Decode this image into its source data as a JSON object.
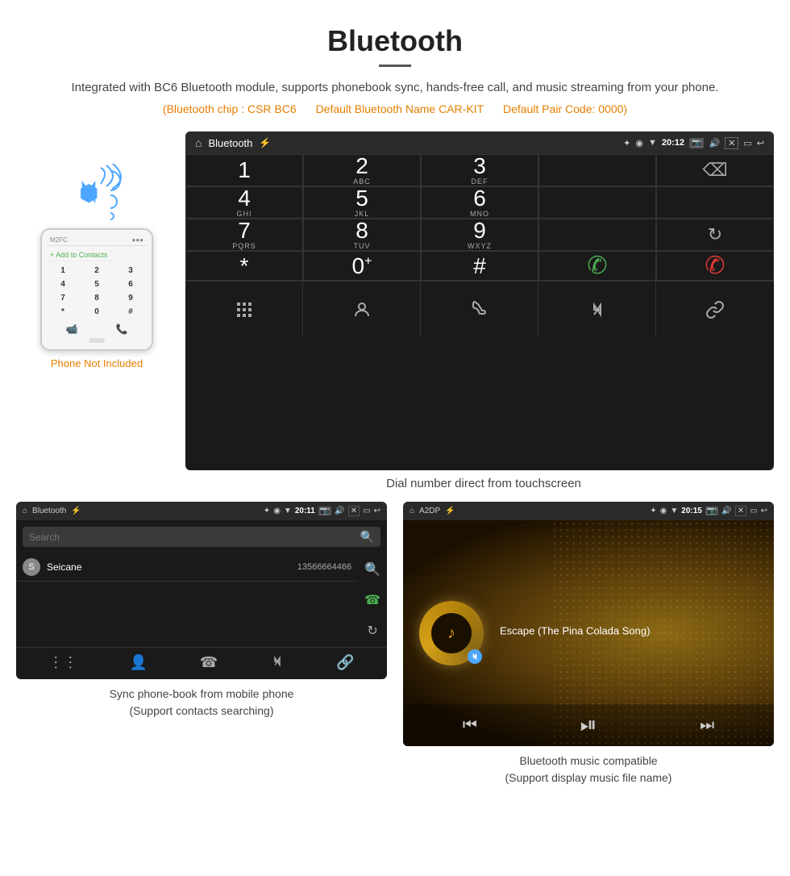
{
  "header": {
    "title": "Bluetooth",
    "description": "Integrated with BC6 Bluetooth module, supports phonebook sync, hands-free call, and music streaming from your phone.",
    "specs": {
      "chip": "(Bluetooth chip : CSR BC6",
      "name": "Default Bluetooth Name CAR-KIT",
      "pair": "Default Pair Code: 0000)"
    }
  },
  "phone_label": "Phone Not Included",
  "car_screen": {
    "status": {
      "title": "Bluetooth",
      "time": "20:12"
    },
    "dialpad": [
      {
        "num": "1",
        "letters": ""
      },
      {
        "num": "2",
        "letters": "ABC"
      },
      {
        "num": "3",
        "letters": "DEF"
      },
      {
        "num": "",
        "letters": ""
      },
      {
        "num": "",
        "letters": ""
      },
      {
        "num": "4",
        "letters": "GHI"
      },
      {
        "num": "5",
        "letters": "JKL"
      },
      {
        "num": "6",
        "letters": "MNO"
      },
      {
        "num": "",
        "letters": ""
      },
      {
        "num": "",
        "letters": ""
      },
      {
        "num": "7",
        "letters": "PQRS"
      },
      {
        "num": "8",
        "letters": "TUV"
      },
      {
        "num": "9",
        "letters": "WXYZ"
      },
      {
        "num": "",
        "letters": ""
      },
      {
        "num": "",
        "letters": ""
      },
      {
        "num": "*",
        "letters": ""
      },
      {
        "num": "0",
        "letters": "+"
      },
      {
        "num": "#",
        "letters": ""
      }
    ]
  },
  "dial_caption": "Dial number direct from touchscreen",
  "phonebook": {
    "status_title": "Bluetooth",
    "status_time": "20:11",
    "search_placeholder": "Search",
    "contact": {
      "initial": "S",
      "name": "Seicane",
      "number": "13566664466"
    },
    "caption_line1": "Sync phone-book from mobile phone",
    "caption_line2": "(Support contacts searching)"
  },
  "music": {
    "status_title": "A2DP",
    "status_time": "20:15",
    "song_title": "Escape (The Pina Colada Song)",
    "caption_line1": "Bluetooth music compatible",
    "caption_line2": "(Support display music file name)"
  },
  "icons": {
    "home": "⌂",
    "usb": "⚡",
    "bluetooth": "₿",
    "location": "◉",
    "wifi": "▼",
    "camera": "⬛",
    "volume": "🔊",
    "close_x": "✕",
    "window": "⬜",
    "back": "↩",
    "backspace": "⌫",
    "call_green": "📞",
    "call_red": "📵",
    "refresh": "↻",
    "grid": "⋮⋮",
    "person": "👤",
    "phone": "☎",
    "bt": "⚡",
    "link": "🔗",
    "prev": "⏮",
    "play_pause": "⏯",
    "next": "⏭",
    "search": "🔍"
  }
}
